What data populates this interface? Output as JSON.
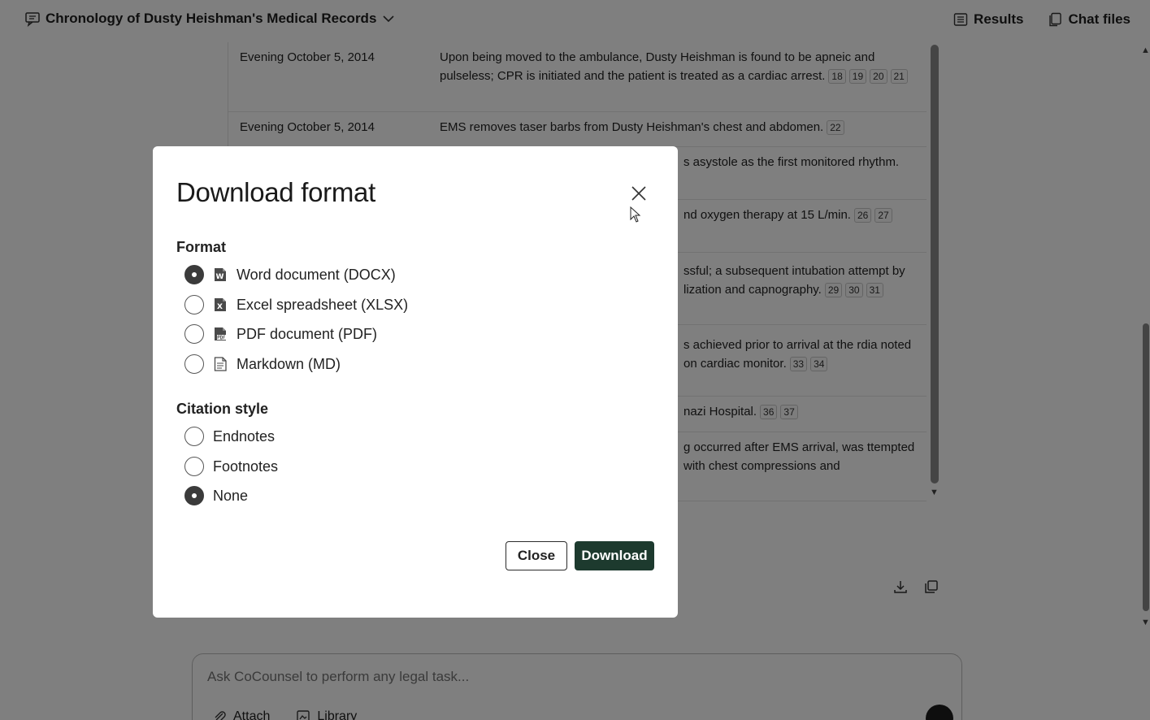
{
  "header": {
    "title": "Chronology of Dusty Heishman's Medical Records",
    "results_label": "Results",
    "chat_files_label": "Chat files"
  },
  "timeline": {
    "rows": [
      {
        "date": "Evening October 5, 2014",
        "text": "Upon being moved to the ambulance, Dusty Heishman is found to be apneic and pulseless; CPR is initiated and the patient is treated as a cardiac arrest.",
        "cites": [
          "18",
          "19",
          "20",
          "21"
        ]
      },
      {
        "date": "Evening October 5, 2014",
        "text": "EMS removes taser barbs from Dusty Heishman's chest and abdomen.",
        "cites": [
          "22"
        ]
      },
      {
        "date": "",
        "text": "s asystole as the first monitored rhythm.",
        "cites": []
      },
      {
        "date": "",
        "text": "nd oxygen therapy at 15 L/min.",
        "cites": [
          "26",
          "27"
        ]
      },
      {
        "date": "",
        "text": "ssful; a subsequent intubation attempt by lization and capnography.",
        "cites": [
          "29",
          "30",
          "31"
        ]
      },
      {
        "date": "",
        "text": "s achieved prior to arrival at the rdia noted on cardiac monitor.",
        "cites": [
          "33",
          "34"
        ]
      },
      {
        "date": "",
        "text": "nazi Hospital.",
        "cites": [
          "36",
          "37"
        ]
      },
      {
        "date": "",
        "text": "g occurred after EMS arrival, was ttempted with chest compressions and",
        "cites": []
      }
    ]
  },
  "chat": {
    "placeholder": "Ask CoCounsel to perform any legal task...",
    "attach_label": "Attach",
    "library_label": "Library"
  },
  "modal": {
    "title": "Download format",
    "format_label": "Format",
    "formats": [
      {
        "label": "Word document (DOCX)",
        "icon": "word-icon",
        "checked": true
      },
      {
        "label": "Excel spreadsheet (XLSX)",
        "icon": "excel-icon",
        "checked": false
      },
      {
        "label": "PDF document (PDF)",
        "icon": "pdf-icon",
        "checked": false
      },
      {
        "label": "Markdown (MD)",
        "icon": "markdown-icon",
        "checked": false
      }
    ],
    "citation_label": "Citation style",
    "citations": [
      {
        "label": "Endnotes",
        "checked": false
      },
      {
        "label": "Footnotes",
        "checked": false
      },
      {
        "label": "None",
        "checked": true
      }
    ],
    "close_label": "Close",
    "download_label": "Download"
  },
  "colors": {
    "download_button": "#1d3a2e",
    "overlay": "rgba(0,0,0,0.5)"
  }
}
